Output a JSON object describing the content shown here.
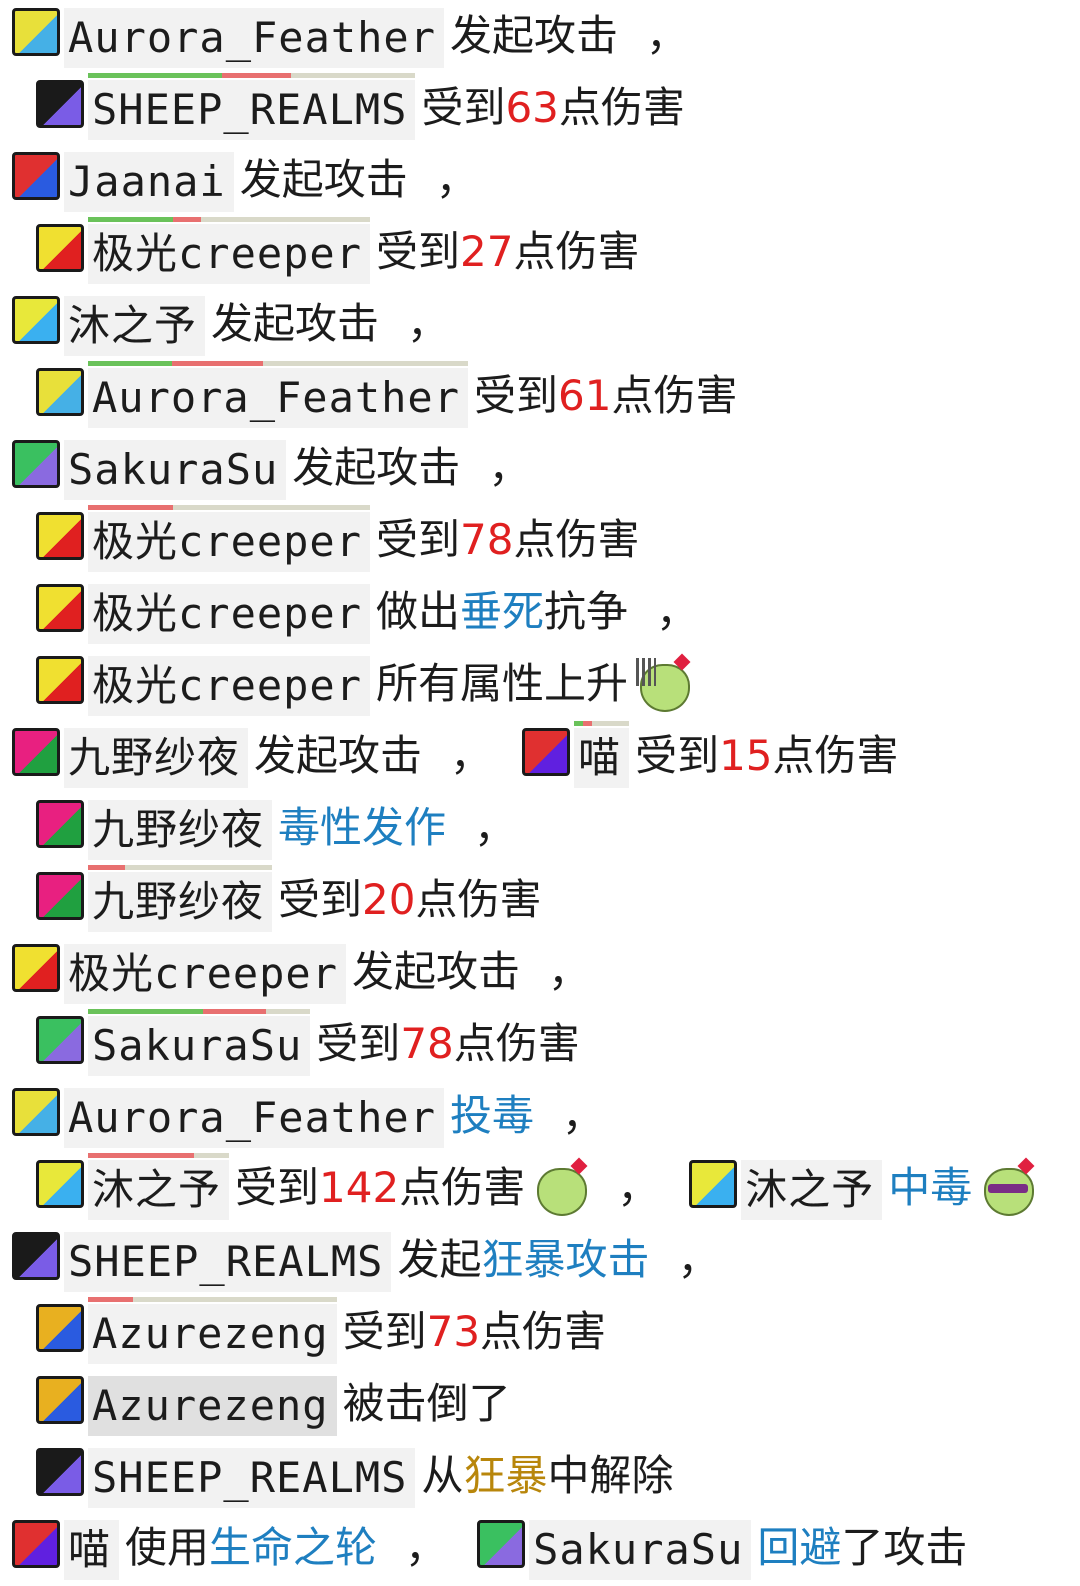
{
  "players": {
    "aurora": {
      "name": "Aurora_Feather",
      "avatar_icon": "aurora-avatar-icon",
      "colors": [
        "#e8e03a",
        "#45b0e6"
      ]
    },
    "sheep": {
      "name": "SHEEP_REALMS",
      "avatar_icon": "sheep-avatar-icon",
      "colors": [
        "#1a1a1a",
        "#7a5ce6"
      ]
    },
    "jaanai": {
      "name": "Jaanai",
      "avatar_icon": "jaanai-avatar-icon",
      "colors": [
        "#e03030",
        "#2a5be0"
      ]
    },
    "creeper": {
      "name": "极光creeper",
      "avatar_icon": "creeper-avatar-icon",
      "colors": [
        "#f0e030",
        "#e02020"
      ]
    },
    "muzhiyu": {
      "name": "沐之予",
      "avatar_icon": "muzhiyu-avatar-icon",
      "colors": [
        "#e8e83a",
        "#3ab0f0"
      ]
    },
    "sakura": {
      "name": "SakuraSu",
      "avatar_icon": "sakura-avatar-icon",
      "colors": [
        "#3ac060",
        "#8a6ae0"
      ]
    },
    "jiuye": {
      "name": "九野纱夜",
      "avatar_icon": "jiuye-avatar-icon",
      "colors": [
        "#e82080",
        "#20a040"
      ]
    },
    "miao": {
      "name": "喵",
      "avatar_icon": "miao-avatar-icon",
      "colors": [
        "#e03030",
        "#6020e0"
      ]
    },
    "azure": {
      "name": "Azurezeng",
      "avatar_icon": "azure-avatar-icon",
      "colors": [
        "#e8b020",
        "#2a5be0"
      ]
    }
  },
  "colors": {
    "damage": "#e02020",
    "skill": "#1e7fc0",
    "buff": "#b8860b"
  },
  "lines": [
    {
      "who": "aurora",
      "text": "发起攻击",
      "comma": "，"
    },
    {
      "who": "sheep",
      "hp": [
        0.41,
        0.21
      ],
      "text_before": "受到",
      "damage": "63",
      "text_after": "点伤害"
    },
    {
      "who": "jaanai",
      "text": "发起攻击",
      "comma": "，"
    },
    {
      "who": "creeper",
      "hp": [
        0.3,
        0.1
      ],
      "text_before": "受到",
      "damage": "27",
      "text_after": "点伤害"
    },
    {
      "who": "muzhiyu",
      "text": "发起攻击",
      "comma": "，"
    },
    {
      "who": "aurora",
      "hp": [
        0.22,
        0.24
      ],
      "text_before": "受到",
      "damage": "61",
      "text_after": "点伤害"
    },
    {
      "who": "sakura",
      "text": "发起攻击",
      "comma": "，"
    },
    {
      "who": "creeper",
      "hp": [
        0.0,
        0.3
      ],
      "text_before": "受到",
      "damage": "78",
      "text_after": "点伤害"
    },
    {
      "who": "creeper",
      "text_before": "做出",
      "skill": "垂死",
      "text_after": "抗争",
      "comma": "，"
    },
    {
      "who": "creeper",
      "text_before": "所有属性上升",
      "emoji": "cactus-buff-emoji"
    },
    {
      "who": "jiuye",
      "text": "发起攻击",
      "comma": "，",
      "target": {
        "who": "miao",
        "hp": [
          0.17,
          0.15
        ],
        "text_before": "受到",
        "damage": "15",
        "text_after": "点伤害"
      }
    },
    {
      "who": "jiuye",
      "skill": "毒性发作",
      "comma": "，"
    },
    {
      "who": "jiuye",
      "hp": [
        0.0,
        0.2
      ],
      "text_before": "受到",
      "damage": "20",
      "text_after": "点伤害"
    },
    {
      "who": "creeper",
      "text": "发起攻击",
      "comma": "，"
    },
    {
      "who": "sakura",
      "hp": [
        0.52,
        0.28
      ],
      "text_before": "受到",
      "damage": "78",
      "text_after": "点伤害"
    },
    {
      "who": "aurora",
      "skill": "投毒",
      "comma": "，"
    },
    {
      "who": "muzhiyu",
      "hp": [
        0.0,
        0.75
      ],
      "text_before": "受到",
      "damage": "142",
      "text_after": "点伤害",
      "emoji": "cactus-cry-emoji",
      "comma": "，",
      "target": {
        "who": "muzhiyu",
        "skill": "中毒",
        "emoji": "cactus-cool-emoji"
      }
    },
    {
      "who": "sheep",
      "text_before": "发起",
      "skill": "狂暴攻击",
      "comma": "，"
    },
    {
      "who": "azure",
      "hp": [
        0.0,
        0.18
      ],
      "text_before": "受到",
      "damage": "73",
      "text_after": "点伤害"
    },
    {
      "who": "azure",
      "dead": true,
      "text": "被击倒了"
    },
    {
      "who": "sheep",
      "text_before": "从",
      "buff": "狂暴",
      "text_after": "中解除"
    },
    {
      "who": "miao",
      "text_before": "使用",
      "skill": "生命之轮",
      "comma": "，",
      "target": {
        "who": "sakura",
        "skill": "回避",
        "text_after": "了攻击"
      }
    }
  ]
}
